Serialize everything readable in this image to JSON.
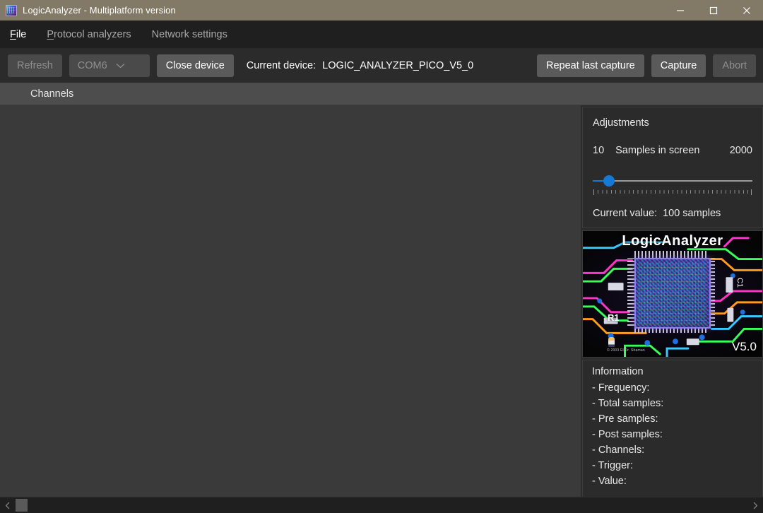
{
  "window": {
    "title": "LogicAnalyzer - Multiplatform version",
    "icon": "app-logo-icon",
    "minimize_label": "—",
    "maximize_label": "□",
    "close_label": "×"
  },
  "menu": {
    "items": [
      {
        "label": "File",
        "accel": "F",
        "rest": "ile",
        "active": true
      },
      {
        "label": "Protocol analyzers",
        "accel": "P",
        "rest": "rotocol analyzers",
        "active": false
      },
      {
        "label": "Network settings",
        "accel": "",
        "rest": "Network settings",
        "active": false
      }
    ]
  },
  "toolbar": {
    "refresh_label": "Refresh",
    "port_value": "COM6",
    "close_device_label": "Close device",
    "current_device_label": "Current device:",
    "current_device_value": "LOGIC_ANALYZER_PICO_V5_0",
    "repeat_capture_label": "Repeat last capture",
    "capture_label": "Capture",
    "abort_label": "Abort"
  },
  "channels": {
    "header": "Channels"
  },
  "adjustments": {
    "title": "Adjustments",
    "slider_min": "10",
    "slider_name": "Samples in screen",
    "slider_max": "2000",
    "current_value_label": "Current value:",
    "current_value": "100 samples",
    "thumb_percent": 10,
    "accent_color": "#157ad6"
  },
  "product_image": {
    "title": "LogicAnalyzer",
    "version": "V5.0",
    "resistor_label": "R1",
    "capacitor_label": "C1",
    "copyright": "© 2003 El Dr. Shaman"
  },
  "information": {
    "title": "Information",
    "lines": [
      "- Frequency:",
      "- Total samples:",
      "- Pre samples:",
      "- Post samples:",
      "- Channels:",
      "- Trigger:",
      "- Value:"
    ]
  },
  "scrollbar": {
    "left_arrow": "‹",
    "right_arrow": "›"
  }
}
